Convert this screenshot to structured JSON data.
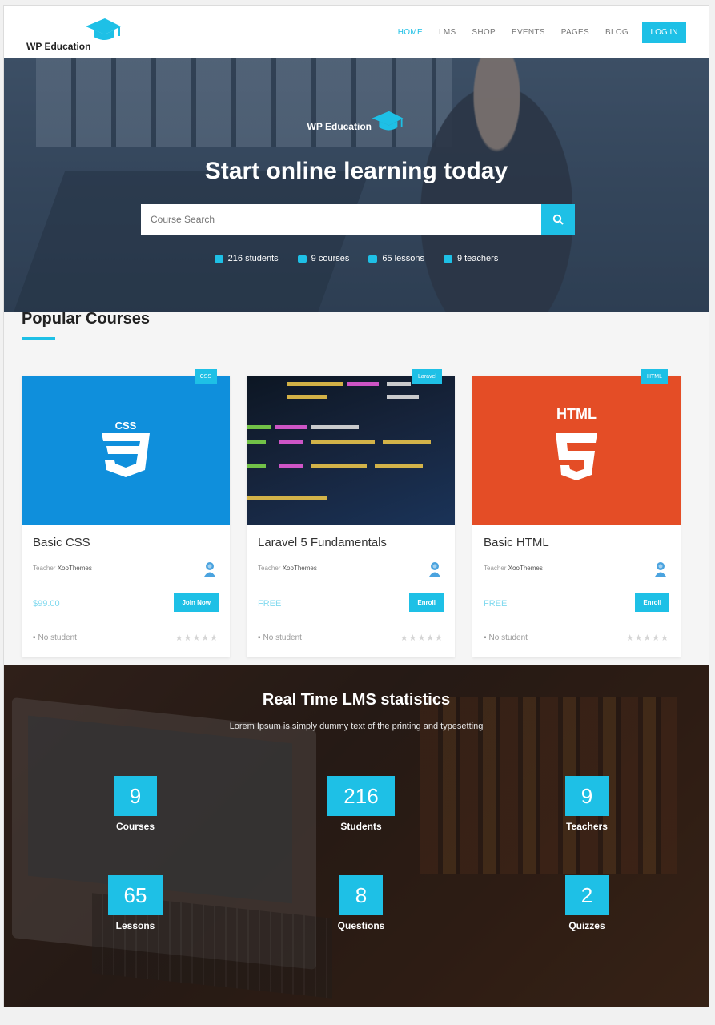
{
  "header": {
    "logo_text": "WP Education",
    "nav": [
      "HOME",
      "LMS",
      "SHOP",
      "EVENTS",
      "PAGES",
      "BLOG"
    ],
    "active_nav": "HOME",
    "login_label": "LOG IN"
  },
  "hero": {
    "logo_text": "WP Education",
    "title": "Start online learning today",
    "search_placeholder": "Course Search",
    "stats": [
      "216 students",
      "9 courses",
      "65 lessons",
      "9 teachers"
    ]
  },
  "popular": {
    "title": "Popular Courses",
    "courses": [
      {
        "tag": "CSS",
        "name": "Basic CSS",
        "teacher_label": "Teacher",
        "teacher": "XooThemes",
        "price": "$99.00",
        "button": "Join Now",
        "students": "No student",
        "stars": "★★★★★",
        "logo_text": "CSS"
      },
      {
        "tag": "Laravel",
        "name": "Laravel 5 Fundamentals",
        "teacher_label": "Teacher",
        "teacher": "XooThemes",
        "price": "FREE",
        "button": "Enroll",
        "students": "No student",
        "stars": "★★★★★"
      },
      {
        "tag": "HTML",
        "name": "Basic HTML",
        "teacher_label": "Teacher",
        "teacher": "XooThemes",
        "price": "FREE",
        "button": "Enroll",
        "students": "No student",
        "stars": "★★★★★",
        "logo_text": "HTML"
      }
    ]
  },
  "stats": {
    "title": "Real Time LMS statistics",
    "subtitle": "Lorem Ipsum is simply dummy text of the printing and typesetting",
    "items": [
      {
        "value": "9",
        "label": "Courses"
      },
      {
        "value": "216",
        "label": "Students"
      },
      {
        "value": "9",
        "label": "Teachers"
      },
      {
        "value": "65",
        "label": "Lessons"
      },
      {
        "value": "8",
        "label": "Questions"
      },
      {
        "value": "2",
        "label": "Quizzes"
      }
    ]
  },
  "colors": {
    "accent": "#1ec0e6",
    "css_blue": "#0f8fdc",
    "html_orange": "#e44d26"
  }
}
